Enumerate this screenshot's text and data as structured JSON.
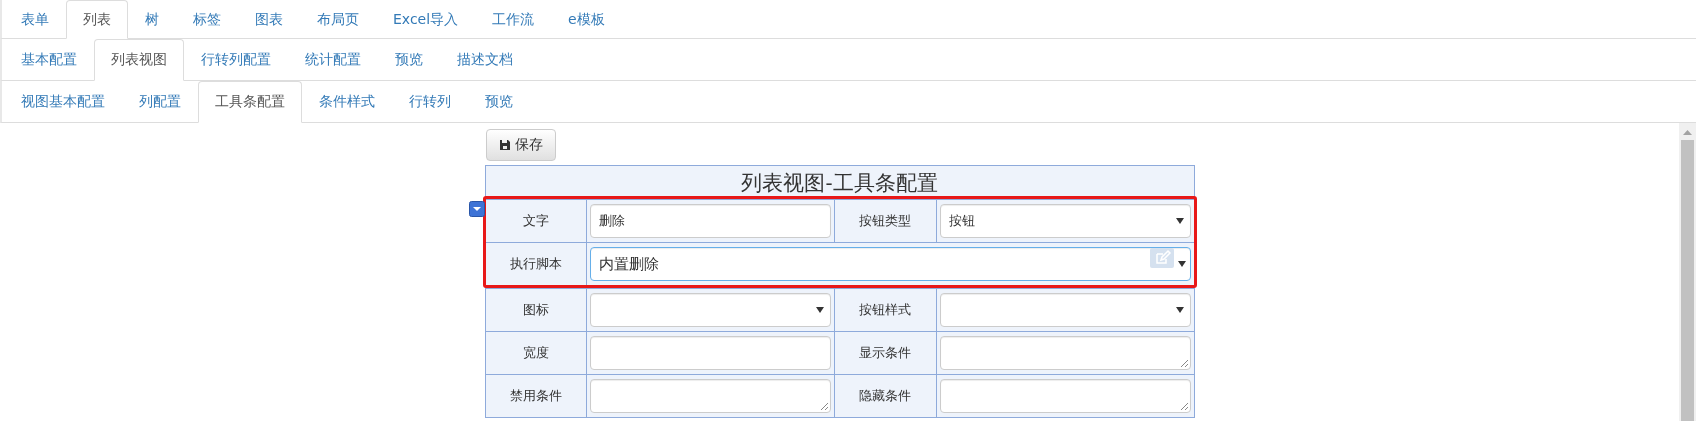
{
  "tab_rows": [
    [
      {
        "label": "表单",
        "selected": false
      },
      {
        "label": "列表",
        "selected": true
      },
      {
        "label": "树",
        "selected": false
      },
      {
        "label": "标签",
        "selected": false
      },
      {
        "label": "图表",
        "selected": false
      },
      {
        "label": "布局页",
        "selected": false
      },
      {
        "label": "Excel导入",
        "selected": false
      },
      {
        "label": "工作流",
        "selected": false
      },
      {
        "label": "e模板",
        "selected": false
      }
    ],
    [
      {
        "label": "基本配置",
        "selected": false
      },
      {
        "label": "列表视图",
        "selected": true
      },
      {
        "label": "行转列配置",
        "selected": false
      },
      {
        "label": "统计配置",
        "selected": false
      },
      {
        "label": "预览",
        "selected": false
      },
      {
        "label": "描述文档",
        "selected": false
      }
    ],
    [
      {
        "label": "视图基本配置",
        "selected": false
      },
      {
        "label": "列配置",
        "selected": false
      },
      {
        "label": "工具条配置",
        "selected": true
      },
      {
        "label": "条件样式",
        "selected": false
      },
      {
        "label": "行转列",
        "selected": false
      },
      {
        "label": "预览",
        "selected": false
      }
    ]
  ],
  "save_button": {
    "label": "保存"
  },
  "form": {
    "title": "列表视图-工具条配置",
    "highlighted_rows": [
      {
        "fields": [
          {
            "label": "文字",
            "kind": "text",
            "value": "删除"
          },
          {
            "label": "按钮类型",
            "kind": "select",
            "value": "按钮"
          }
        ]
      },
      {
        "fields": [
          {
            "label": "执行脚本",
            "kind": "script",
            "value": "内置删除"
          }
        ]
      }
    ],
    "rows": [
      {
        "fields": [
          {
            "label": "图标",
            "kind": "select"
          },
          {
            "label": "按钮样式",
            "kind": "select"
          }
        ]
      },
      {
        "fields": [
          {
            "label": "宽度",
            "kind": "text"
          },
          {
            "label": "显示条件",
            "kind": "textarea"
          }
        ]
      },
      {
        "fields": [
          {
            "label": "禁用条件",
            "kind": "textarea"
          },
          {
            "label": "隐藏条件",
            "kind": "textarea"
          }
        ]
      }
    ]
  }
}
